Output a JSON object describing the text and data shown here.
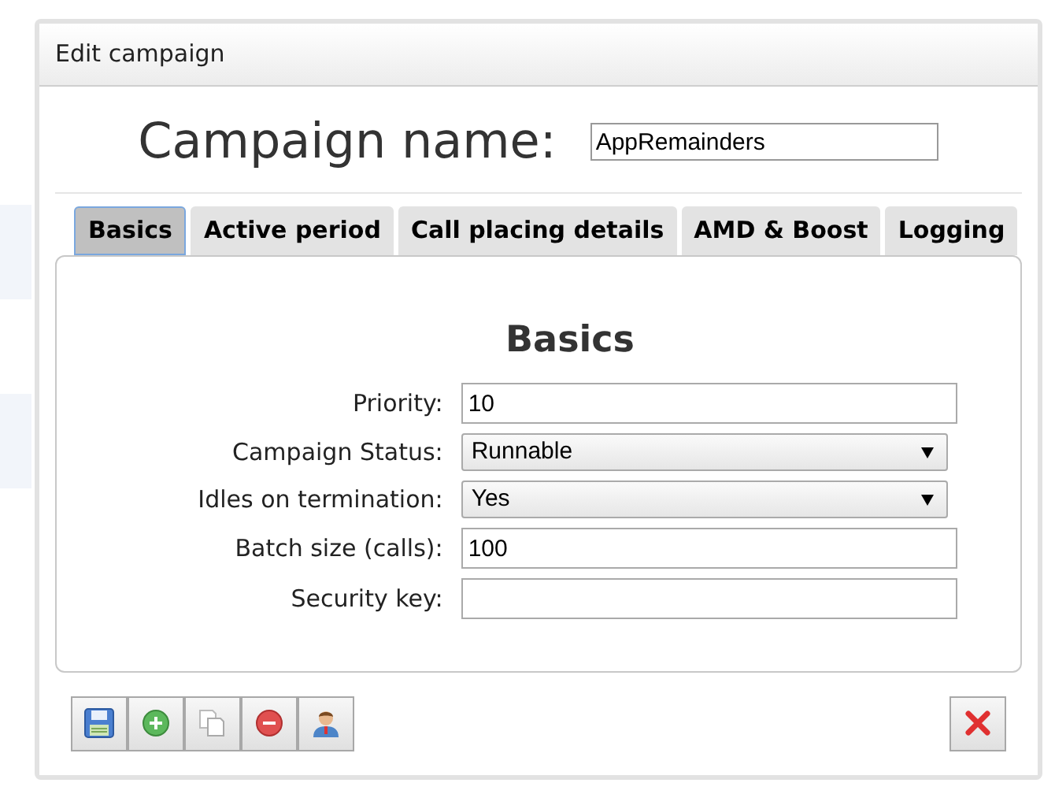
{
  "window": {
    "title": "Edit campaign"
  },
  "campaign_name": {
    "label": "Campaign name:",
    "value": "AppRemainders"
  },
  "tabs": [
    {
      "label": "Basics",
      "selected": true
    },
    {
      "label": "Active period",
      "selected": false
    },
    {
      "label": "Call placing details",
      "selected": false
    },
    {
      "label": "AMD & Boost",
      "selected": false
    },
    {
      "label": "Logging",
      "selected": false
    }
  ],
  "section_title": "Basics",
  "fields": [
    {
      "label": "Priority:",
      "kind": "input",
      "value": "10"
    },
    {
      "label": "Campaign Status:",
      "kind": "select",
      "value": "Runnable"
    },
    {
      "label": "Idles on termination:",
      "kind": "select",
      "value": "Yes"
    },
    {
      "label": "Batch size (calls):",
      "kind": "input",
      "value": "100"
    },
    {
      "label": "Security key:",
      "kind": "input"
    }
  ],
  "toolbar": [
    {
      "kind": "save"
    },
    {
      "kind": "add"
    },
    {
      "kind": "copy"
    },
    {
      "kind": "remove"
    },
    {
      "kind": "user"
    }
  ],
  "close_button": {
    "kind": "close"
  }
}
